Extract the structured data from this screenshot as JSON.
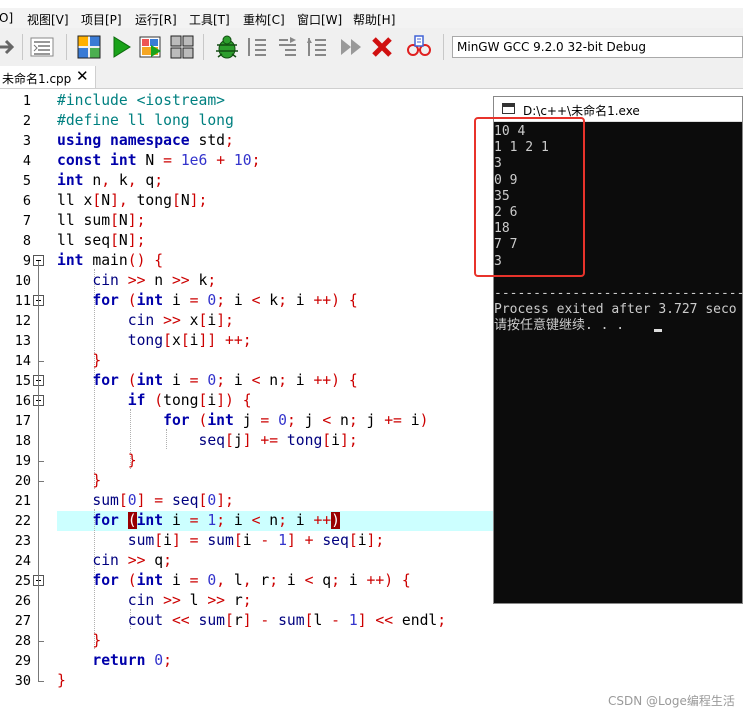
{
  "menu": [
    "O]",
    "视图[V]",
    "项目[P]",
    "运行[R]",
    "工具[T]",
    "重构[C]",
    "窗口[W]",
    "帮助[H]"
  ],
  "toolbar": {
    "icons": [
      "forward-arrow-icon",
      "indent-icon",
      "new-project-icon",
      "run-icon",
      "compile-run-icon",
      "grid-icon",
      "debug-bug-icon",
      "step-into-icon",
      "step-over-icon",
      "step-out-icon",
      "continue-icon",
      "stop-icon",
      "profile-icon"
    ],
    "compiler_select": "MinGW GCC 9.2.0 32-bit Debug"
  },
  "tab": {
    "label": "未命名1.cpp",
    "close": "✕"
  },
  "editor": {
    "line_numbers": [
      "1",
      "2",
      "3",
      "4",
      "5",
      "6",
      "7",
      "8",
      "9",
      "10",
      "11",
      "12",
      "13",
      "14",
      "15",
      "16",
      "17",
      "18",
      "19",
      "20",
      "21",
      "22",
      "23",
      "24",
      "25",
      "26",
      "27",
      "28",
      "29",
      "30"
    ],
    "highlighted_line": 22
  },
  "console": {
    "title": "D:\\c++\\未命名1.exe",
    "lines": [
      "10 4",
      "1 1 2 1",
      "3",
      "0 9",
      "35",
      "2 6",
      "18",
      "7 7",
      "3",
      "",
      "--------------------------------",
      "Process exited after 3.727 seco",
      "请按任意键继续. . ."
    ]
  },
  "colors": {
    "annotation_box": "#e8332b",
    "current_line": "#ccffff",
    "keyword": "#0000aa",
    "operator": "#cc0000"
  },
  "watermark": "CSDN @Loge编程生活"
}
